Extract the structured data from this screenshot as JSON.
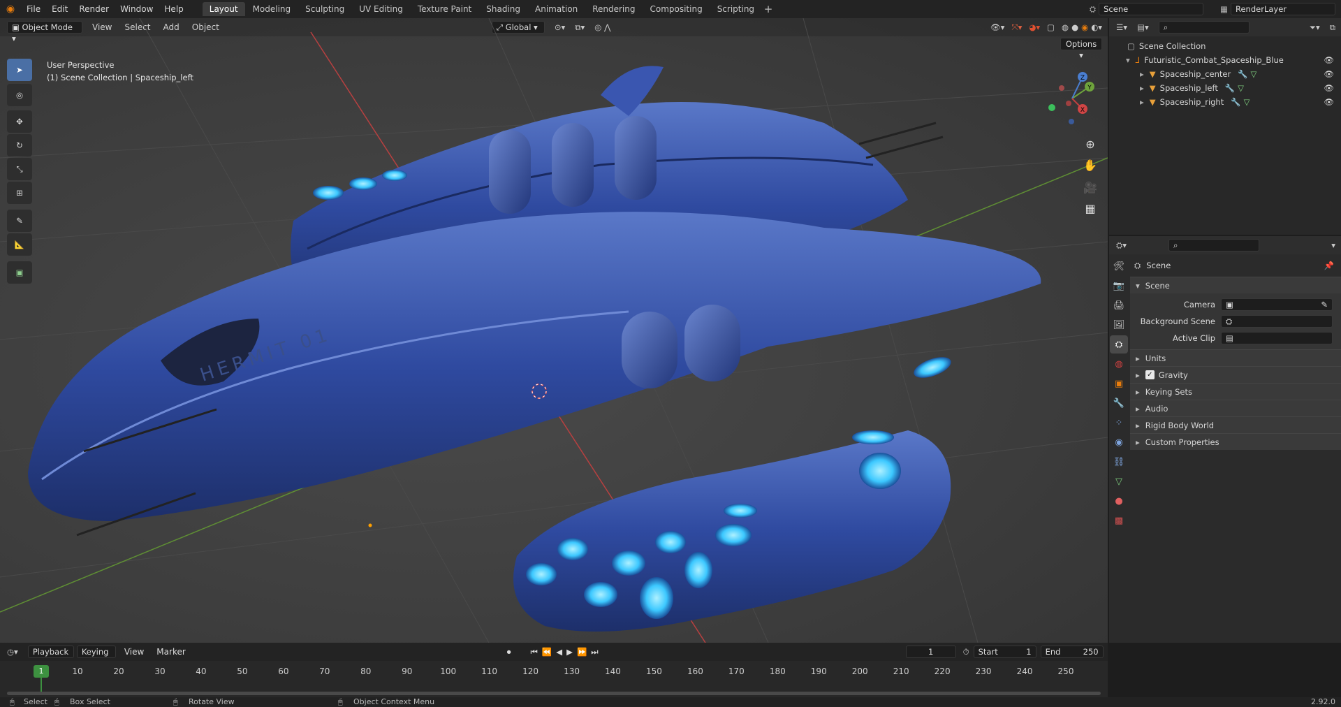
{
  "menu": [
    "File",
    "Edit",
    "Render",
    "Window",
    "Help"
  ],
  "workspaces": [
    "Layout",
    "Modeling",
    "Sculpting",
    "UV Editing",
    "Texture Paint",
    "Shading",
    "Animation",
    "Rendering",
    "Compositing",
    "Scripting"
  ],
  "active_workspace": "Layout",
  "scene_name": "Scene",
  "render_layer": "RenderLayer",
  "viewport": {
    "mode": "Object Mode",
    "menus": [
      "View",
      "Select",
      "Add",
      "Object"
    ],
    "orientation": "Global",
    "options": "Options",
    "view_name": "User Perspective",
    "collection_info": "(1) Scene Collection | Spaceship_left",
    "hull_text": "HERMIT 01",
    "gizmo": {
      "x": "X",
      "y": "Y",
      "z": "Z"
    }
  },
  "outliner": {
    "root": "Scene Collection",
    "collection": "Futuristic_Combat_Spaceship_Blue",
    "objects": [
      "Spaceship_center",
      "Spaceship_left",
      "Spaceship_right"
    ]
  },
  "properties": {
    "header": "Scene",
    "panel": "Scene",
    "fields": [
      {
        "label": "Camera"
      },
      {
        "label": "Background Scene"
      },
      {
        "label": "Active Clip"
      }
    ],
    "sections": [
      "Units",
      "Gravity",
      "Keying Sets",
      "Audio",
      "Rigid Body World",
      "Custom Properties"
    ]
  },
  "timeline": {
    "menus": [
      "Playback",
      "Keying",
      "View",
      "Marker"
    ],
    "current_frame": "1",
    "start_label": "Start",
    "start": "1",
    "end_label": "End",
    "end": "250",
    "ticks": [
      "1",
      "10",
      "20",
      "30",
      "40",
      "50",
      "60",
      "70",
      "80",
      "90",
      "100",
      "110",
      "120",
      "130",
      "140",
      "150",
      "160",
      "170",
      "180",
      "190",
      "200",
      "210",
      "220",
      "230",
      "240",
      "250"
    ]
  },
  "status": {
    "select": "Select",
    "box_select": "Box Select",
    "rotate": "Rotate View",
    "context": "Object Context Menu",
    "version": "2.92.0"
  },
  "colors": {
    "accent": "#4a6fa5",
    "ship": "#2f4aa0",
    "glow": "#3cc8ff",
    "axis_x": "#c04040",
    "axis_y": "#6ea33c"
  }
}
